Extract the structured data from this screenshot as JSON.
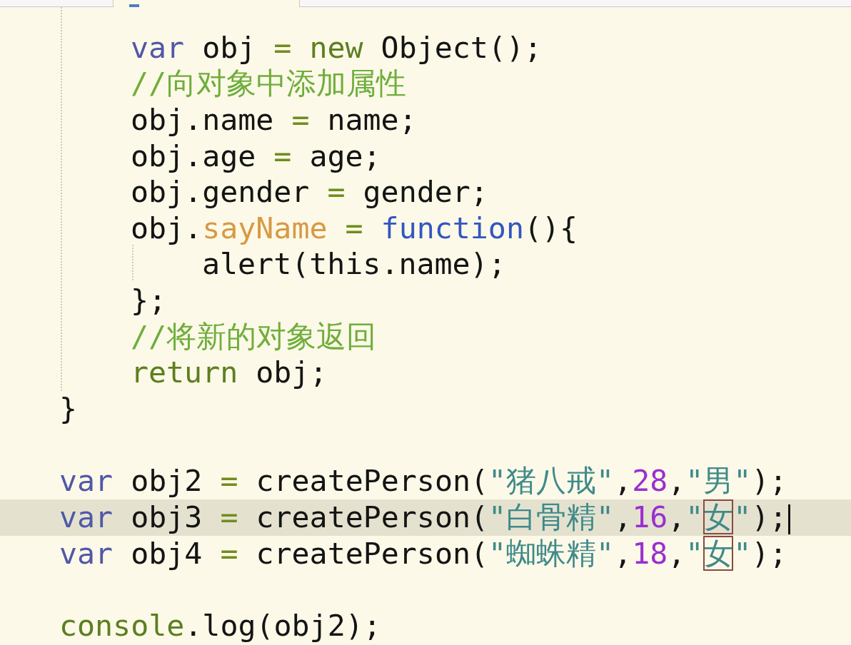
{
  "tab_bar": {
    "tabs": [
      {
        "selected": true
      }
    ]
  },
  "editor": {
    "lines": [
      {
        "kind": "block",
        "children": [
          {
            "kind": "blank",
            "highlighted": false
          },
          {
            "kind": "code",
            "highlighted": false,
            "tokens": [
              {
                "kind": "keyword",
                "text": "var"
              },
              {
                "kind": "plain",
                "text": " obj"
              },
              {
                "kind": "operator",
                "text": " = "
              },
              {
                "kind": "builtin",
                "text": "new"
              },
              {
                "kind": "plain",
                "text": " Object();"
              }
            ]
          },
          {
            "kind": "code",
            "highlighted": false,
            "tokens": [
              {
                "kind": "comment",
                "text": "//向对象中添加属性"
              }
            ]
          },
          {
            "kind": "code",
            "highlighted": false,
            "tokens": [
              {
                "kind": "plain",
                "text": "obj.name"
              },
              {
                "kind": "operator",
                "text": " = "
              },
              {
                "kind": "plain",
                "text": "name;"
              }
            ]
          },
          {
            "kind": "code",
            "highlighted": false,
            "tokens": [
              {
                "kind": "plain",
                "text": "obj.age"
              },
              {
                "kind": "operator",
                "text": " = "
              },
              {
                "kind": "plain",
                "text": "age;"
              }
            ]
          },
          {
            "kind": "code",
            "highlighted": false,
            "tokens": [
              {
                "kind": "plain",
                "text": "obj.gender"
              },
              {
                "kind": "operator",
                "text": " = "
              },
              {
                "kind": "plain",
                "text": "gender;"
              }
            ]
          },
          {
            "kind": "code",
            "highlighted": false,
            "tokens": [
              {
                "kind": "plain",
                "text": "obj."
              },
              {
                "kind": "property",
                "text": "sayName"
              },
              {
                "kind": "operator",
                "text": " = "
              },
              {
                "kind": "function",
                "text": "function"
              },
              {
                "kind": "plain",
                "text": "(){"
              }
            ],
            "children": [
              {
                "kind": "code",
                "highlighted": false,
                "tokens": [
                  {
                    "kind": "plain",
                    "text": "alert(this.name);"
                  }
                ]
              }
            ]
          },
          {
            "kind": "code",
            "highlighted": false,
            "tokens": [
              {
                "kind": "plain",
                "text": "};"
              }
            ]
          },
          {
            "kind": "code",
            "highlighted": false,
            "tokens": [
              {
                "kind": "comment",
                "text": "//将新的对象返回"
              }
            ]
          },
          {
            "kind": "code",
            "highlighted": false,
            "tokens": [
              {
                "kind": "builtin",
                "text": "return"
              },
              {
                "kind": "plain",
                "text": " obj;"
              }
            ]
          }
        ]
      },
      {
        "kind": "code",
        "highlighted": false,
        "tokens": [
          {
            "kind": "plain",
            "text": "}"
          }
        ]
      },
      {
        "kind": "blank",
        "highlighted": false
      },
      {
        "kind": "code",
        "highlighted": false,
        "tokens": [
          {
            "kind": "keyword",
            "text": "var"
          },
          {
            "kind": "plain",
            "text": " obj2"
          },
          {
            "kind": "operator",
            "text": " = "
          },
          {
            "kind": "plain",
            "text": "createPerson("
          },
          {
            "kind": "string",
            "text": "\"猪八戒\""
          },
          {
            "kind": "plain",
            "text": ","
          },
          {
            "kind": "number",
            "text": "28"
          },
          {
            "kind": "plain",
            "text": ","
          },
          {
            "kind": "string",
            "text": "\"男\""
          },
          {
            "kind": "plain",
            "text": ");"
          }
        ]
      },
      {
        "kind": "code",
        "highlighted": true,
        "cursor": true,
        "tokens": [
          {
            "kind": "keyword",
            "text": "var"
          },
          {
            "kind": "plain",
            "text": " obj3"
          },
          {
            "kind": "operator",
            "text": " = "
          },
          {
            "kind": "plain",
            "text": "createPerson("
          },
          {
            "kind": "string",
            "text": "\"白骨精\""
          },
          {
            "kind": "plain",
            "text": ","
          },
          {
            "kind": "number",
            "text": "16"
          },
          {
            "kind": "plain",
            "text": ","
          },
          {
            "kind": "string",
            "text": "\""
          },
          {
            "kind": "string",
            "text": "女",
            "matched": true
          },
          {
            "kind": "string",
            "text": "\""
          },
          {
            "kind": "plain",
            "text": ");"
          }
        ]
      },
      {
        "kind": "code",
        "highlighted": false,
        "tokens": [
          {
            "kind": "keyword",
            "text": "var"
          },
          {
            "kind": "plain",
            "text": " obj4"
          },
          {
            "kind": "operator",
            "text": " = "
          },
          {
            "kind": "plain",
            "text": "createPerson("
          },
          {
            "kind": "string",
            "text": "\"蜘蛛精\""
          },
          {
            "kind": "plain",
            "text": ","
          },
          {
            "kind": "number",
            "text": "18"
          },
          {
            "kind": "plain",
            "text": ","
          },
          {
            "kind": "string",
            "text": "\""
          },
          {
            "kind": "string",
            "text": "女",
            "matched": true
          },
          {
            "kind": "string",
            "text": "\""
          },
          {
            "kind": "plain",
            "text": ");"
          }
        ]
      },
      {
        "kind": "blank",
        "highlighted": false
      },
      {
        "kind": "code",
        "highlighted": false,
        "tokens": [
          {
            "kind": "builtin",
            "text": "console"
          },
          {
            "kind": "plain",
            "text": ".log(obj2);"
          }
        ]
      }
    ]
  }
}
